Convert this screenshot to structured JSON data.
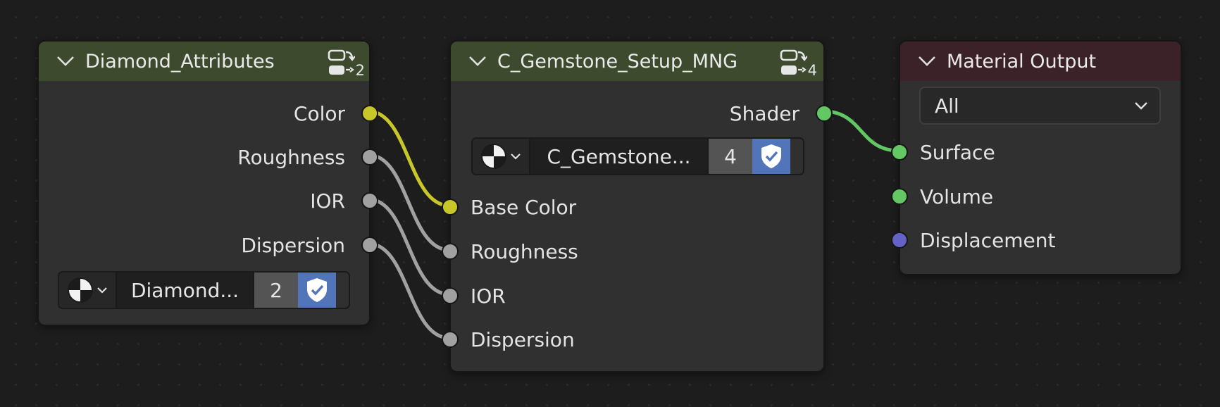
{
  "nodes": {
    "diamond": {
      "title": "Diamond_Attributes",
      "user_count": "2",
      "outputs": [
        "Color",
        "Roughness",
        "IOR",
        "Dispersion"
      ],
      "datablock": {
        "name": "Diamond...",
        "users": "2"
      }
    },
    "gemstone": {
      "title": "C_Gemstone_Setup_MNG",
      "user_count": "4",
      "output": "Shader",
      "datablock": {
        "name": "C_Gemstone...",
        "users": "4"
      },
      "inputs": [
        "Base Color",
        "Roughness",
        "IOR",
        "Dispersion"
      ]
    },
    "output": {
      "title": "Material Output",
      "target": "All",
      "inputs": [
        "Surface",
        "Volume",
        "Displacement"
      ]
    }
  },
  "colors": {
    "background": "#1d1d1d",
    "node_body": "#303030",
    "group_header": "#3d4a2e",
    "output_header": "#3b2228",
    "socket_color": "#c7c729",
    "socket_float": "#a1a1a1",
    "socket_shader": "#63c763",
    "socket_vector": "#6363c7",
    "fake_user": "#5274b8"
  },
  "icons": [
    "chevron-down-icon",
    "node-group-icon",
    "material-ball-icon",
    "shield-check-icon"
  ]
}
